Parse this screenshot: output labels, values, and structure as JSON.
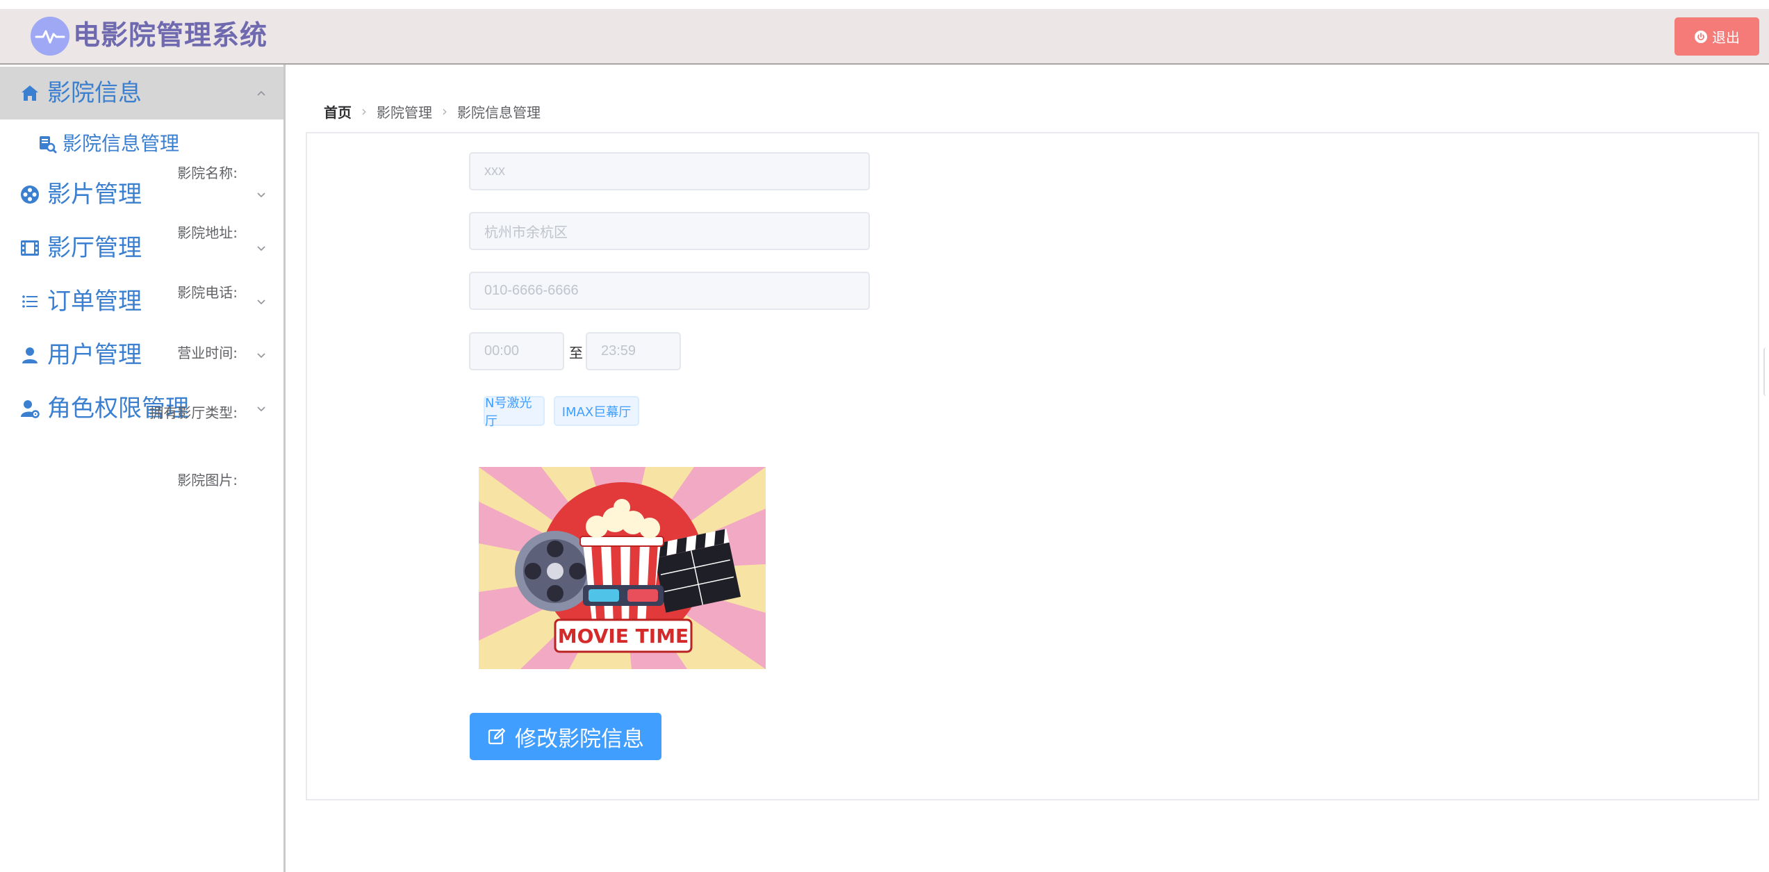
{
  "header": {
    "title": "电影院管理系统",
    "logout_label": "退出",
    "logo_icon": "activity-pulse-icon",
    "logout_icon": "power-icon",
    "colors": {
      "bar": "#ede6e6",
      "title": "#6f6ab0",
      "logout": "#f57b78"
    }
  },
  "sidebar": {
    "items": [
      {
        "label": "影院信息",
        "icon": "home-icon",
        "expanded": true,
        "children": [
          {
            "label": "影院信息管理",
            "icon": "document-search-icon"
          }
        ]
      },
      {
        "label": "影片管理",
        "icon": "film-reel-icon",
        "expanded": false
      },
      {
        "label": "影厅管理",
        "icon": "film-strip-icon",
        "expanded": false
      },
      {
        "label": "订单管理",
        "icon": "list-icon",
        "expanded": false
      },
      {
        "label": "用户管理",
        "icon": "user-icon",
        "expanded": false
      },
      {
        "label": "角色权限管理",
        "icon": "user-settings-icon",
        "expanded": false
      }
    ],
    "colors": {
      "active_bg": "#d6d6d6",
      "text": "#3a7fd0"
    }
  },
  "breadcrumb": [
    "首页",
    "影院管理",
    "影院信息管理"
  ],
  "form": {
    "name": {
      "label": "影院名称:",
      "placeholder": "xxx"
    },
    "address": {
      "label": "影院地址:",
      "placeholder": "杭州市余杭区"
    },
    "phone": {
      "label": "影院电话:",
      "placeholder": "010-6666-6666"
    },
    "hours": {
      "label": "营业时间:",
      "start_placeholder": "00:00",
      "separator": "至",
      "end_placeholder": "23:59"
    },
    "hall_types": {
      "label": "拥有影厅类型:",
      "tags": [
        "N号激光厅",
        "IMAX巨幕厅"
      ]
    },
    "image": {
      "label": "影院图片:",
      "poster_text": "MOVIE TIME"
    },
    "submit_label": "修改影院信息",
    "submit_icon": "edit-icon",
    "colors": {
      "primary": "#409eff",
      "tag_bg": "#ecf5ff"
    }
  }
}
